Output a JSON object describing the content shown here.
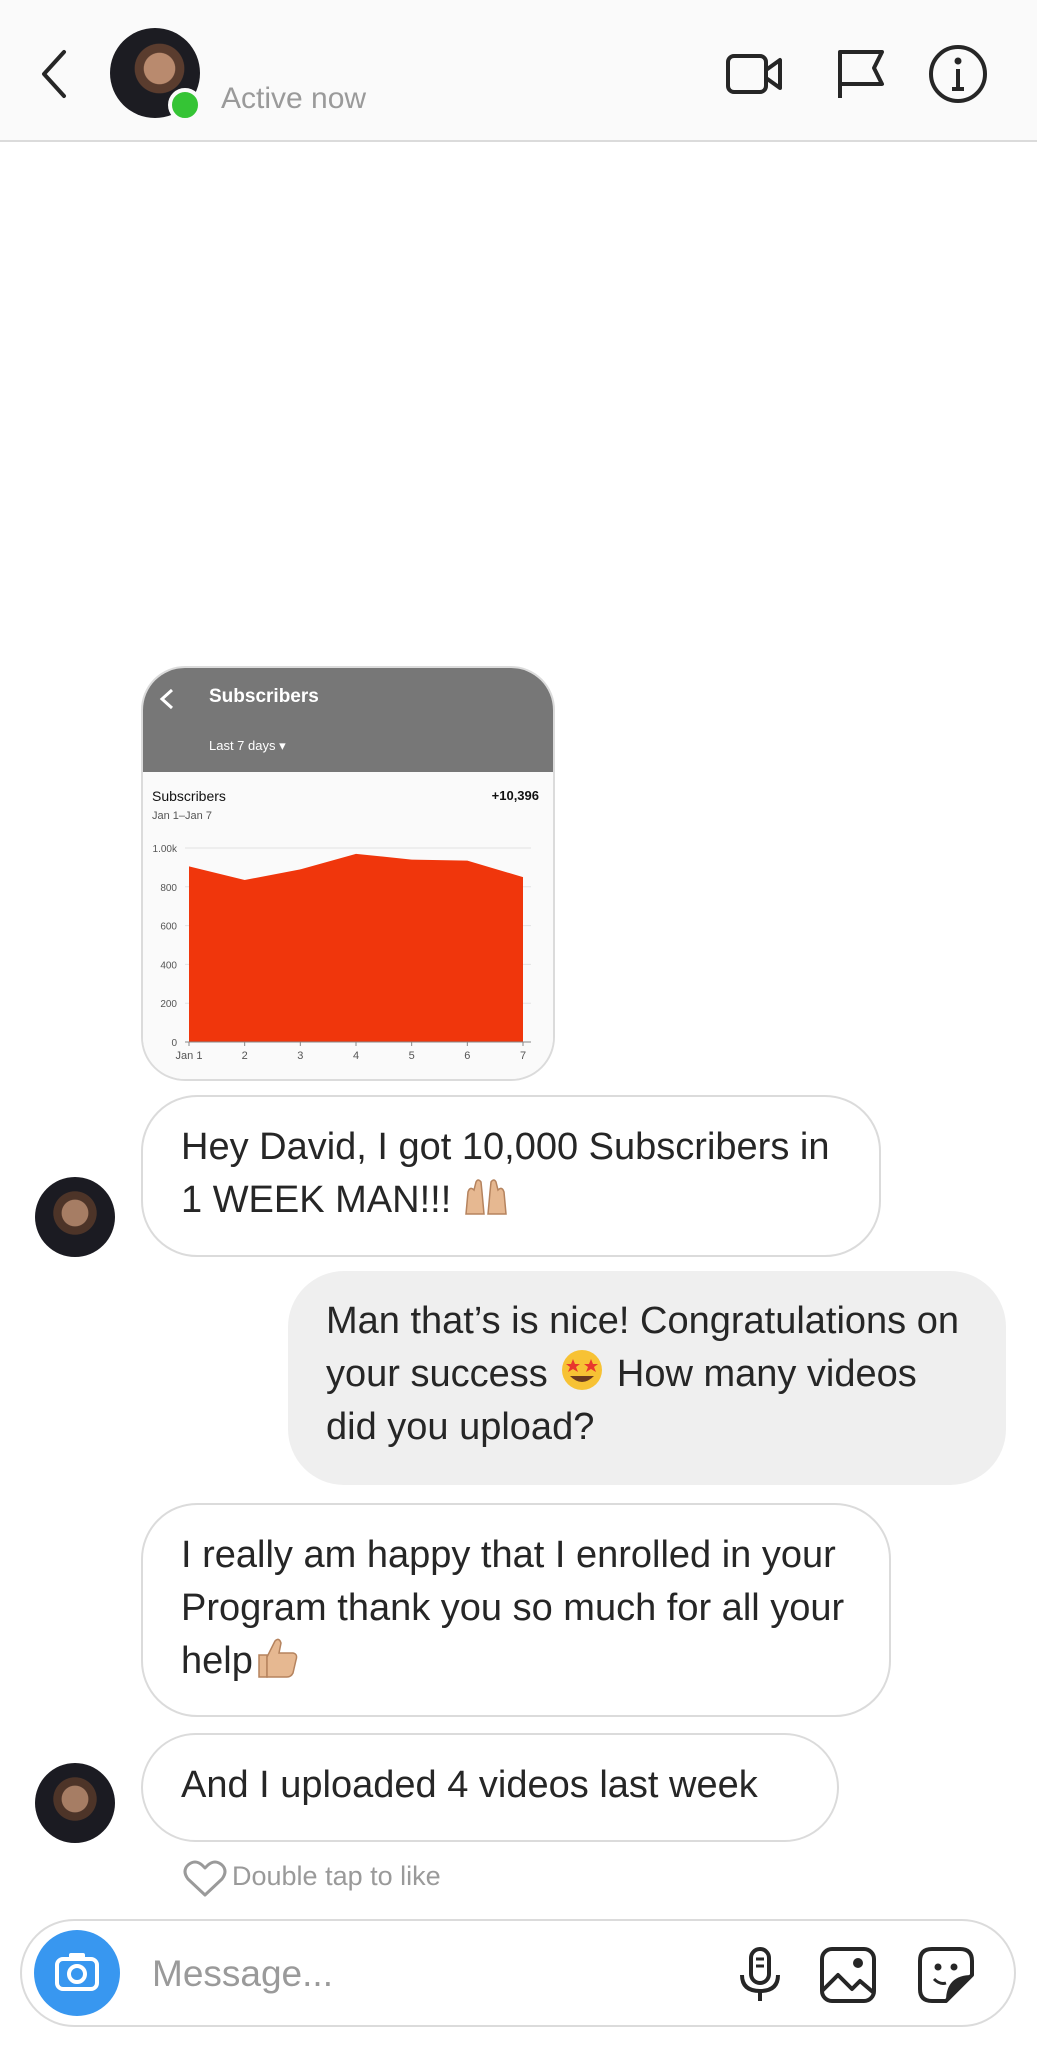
{
  "header": {
    "status": "Active now",
    "colors": {
      "presence": "#35c435",
      "background": "#fafafa"
    },
    "icons": [
      "back-arrow-icon",
      "video-call-icon",
      "flag-icon",
      "info-icon"
    ]
  },
  "shared_screenshot": {
    "title": "Subscribers",
    "range": "Last 7 days",
    "metric": "Subscribers",
    "date_range": "Jan 1–Jan 7",
    "total": "+10,396",
    "chart_data": {
      "type": "area",
      "x": [
        "Jan 1",
        "2",
        "3",
        "4",
        "5",
        "6",
        "7"
      ],
      "y_ticks": [
        "0",
        "200",
        "400",
        "600",
        "800",
        "1.00k"
      ],
      "ylim": [
        0,
        1000
      ],
      "series": [
        {
          "values": [
            905,
            835,
            890,
            970,
            940,
            935,
            850
          ]
        }
      ],
      "color": "#f0360c"
    }
  },
  "messages": [
    {
      "from": "them",
      "text": "Hey David, I got 10,000 Subscribers in 1 WEEK MAN!!!",
      "emoji": "raising-hands-emoji"
    },
    {
      "from": "me",
      "text": "Man that’s is nice! Congratulations on your success",
      "emoji": "star-struck-emoji",
      "text_after": "How many videos did you upload?"
    },
    {
      "from": "them",
      "text": "I really am happy that I enrolled in your Program thank you so much for all your help",
      "emoji": "thumbs-up-emoji"
    },
    {
      "from": "them",
      "text": "And I uploaded 4 videos last week"
    }
  ],
  "like_hint": "Double tap to like",
  "composer": {
    "placeholder": "Message...",
    "icons": [
      "camera-icon",
      "microphone-icon",
      "gallery-icon",
      "sticker-icon"
    ],
    "accent": "#3897f0"
  }
}
